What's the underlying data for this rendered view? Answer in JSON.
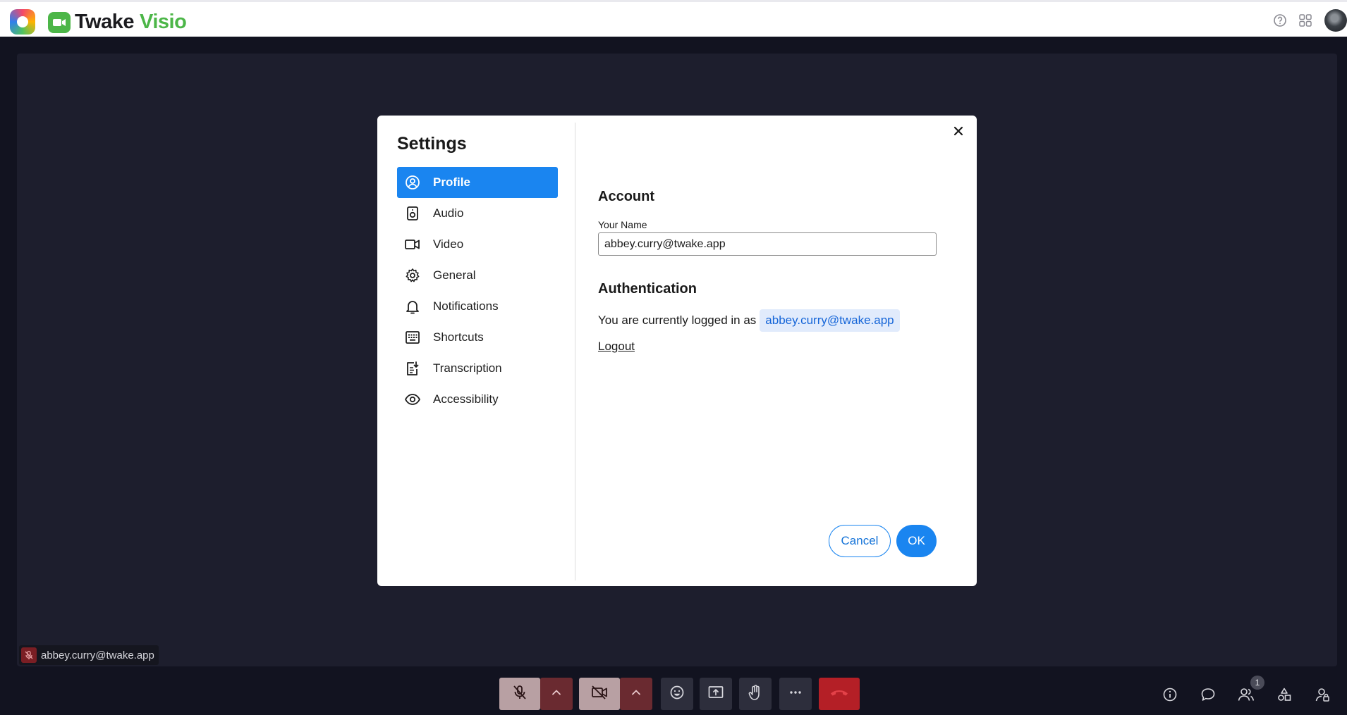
{
  "app": {
    "brand_name": "Twake",
    "brand_accent": "Visio",
    "brand_color": "#4cb648"
  },
  "header": {
    "icons": [
      "help-icon",
      "apps-grid-icon",
      "user-avatar"
    ]
  },
  "settings": {
    "title": "Settings",
    "menu": [
      {
        "label": "Profile",
        "icon": "profile-icon",
        "active": true
      },
      {
        "label": "Audio",
        "icon": "speaker-icon"
      },
      {
        "label": "Video",
        "icon": "video-camera-icon"
      },
      {
        "label": "General",
        "icon": "gear-icon"
      },
      {
        "label": "Notifications",
        "icon": "bell-icon"
      },
      {
        "label": "Shortcuts",
        "icon": "keyboard-icon"
      },
      {
        "label": "Transcription",
        "icon": "transcript-icon"
      },
      {
        "label": "Accessibility",
        "icon": "eye-icon"
      }
    ],
    "account": {
      "heading": "Account",
      "name_label": "Your Name",
      "name_value": "abbey.curry@twake.app"
    },
    "authentication": {
      "heading": "Authentication",
      "logged_in_text": "You are currently logged in as",
      "email": "abbey.curry@twake.app",
      "logout_label": "Logout"
    },
    "buttons": {
      "cancel": "Cancel",
      "ok": "OK"
    },
    "accent_color": "#1a85f0"
  },
  "participant": {
    "name": "abbey.curry@twake.app",
    "mic_muted": true
  },
  "toolbar": {
    "participants_count": "1",
    "hangup_color": "#b41f26"
  }
}
